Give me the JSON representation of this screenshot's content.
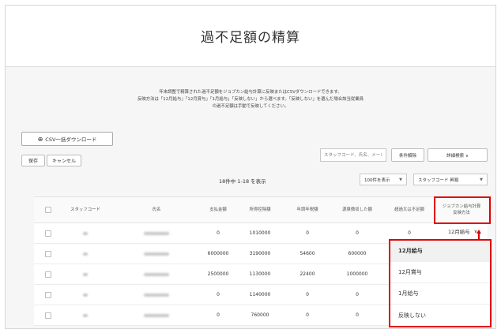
{
  "page": {
    "title": "過不足額の精算",
    "description": [
      "年末調整で精算された過不足額をジョブカン給与計算に反映またはCSVダウンロードできます。",
      "反映方法は「12月給与」「12月賞与」「1月給与」「反映しない」から選べます。「反映しない」を選んだ場合該当従業員",
      "の過不足額は手動で反映してください。"
    ]
  },
  "toolbar": {
    "csv_icon": "download-icon",
    "csv_label": "CSV一括ダウンロード",
    "save_label": "保存",
    "cancel_label": "キャンセル",
    "search_placeholder": "スタッフコード、氏名、メール",
    "clear_label": "条件解除",
    "advanced_label": "詳細検索 ∨"
  },
  "list": {
    "count_text": "18件中 1-18 を表示",
    "per_page": "100件を表示",
    "sort": "スタッフコード 昇順"
  },
  "table": {
    "headers": [
      "スタッフコード",
      "氏名",
      "支払金額",
      "所得控除額",
      "年調年税額",
      "源泉徴収した額",
      "超過又は不足額",
      "ジョブカン給与計算",
      "反映方法"
    ],
    "rows": [
      {
        "paid": "0",
        "deduction": "1010000",
        "tax": "0",
        "withheld": "0",
        "diff": "0",
        "method": "12月給与"
      },
      {
        "paid": "6000000",
        "deduction": "3190000",
        "tax": "54600",
        "withheld": "600000",
        "diff": "",
        "method": ""
      },
      {
        "paid": "2500000",
        "deduction": "1130000",
        "tax": "22400",
        "withheld": "1000000",
        "diff": "",
        "method": ""
      },
      {
        "paid": "0",
        "deduction": "1140000",
        "tax": "0",
        "withheld": "0",
        "diff": "",
        "method": ""
      },
      {
        "paid": "0",
        "deduction": "760000",
        "tax": "0",
        "withheld": "0",
        "diff": "",
        "method": ""
      }
    ]
  },
  "dropdown": {
    "selected": "12月給与",
    "options": [
      "12月給与",
      "12月賞与",
      "1月給与",
      "反映しない"
    ]
  },
  "colors": {
    "highlight": "#e00000"
  }
}
